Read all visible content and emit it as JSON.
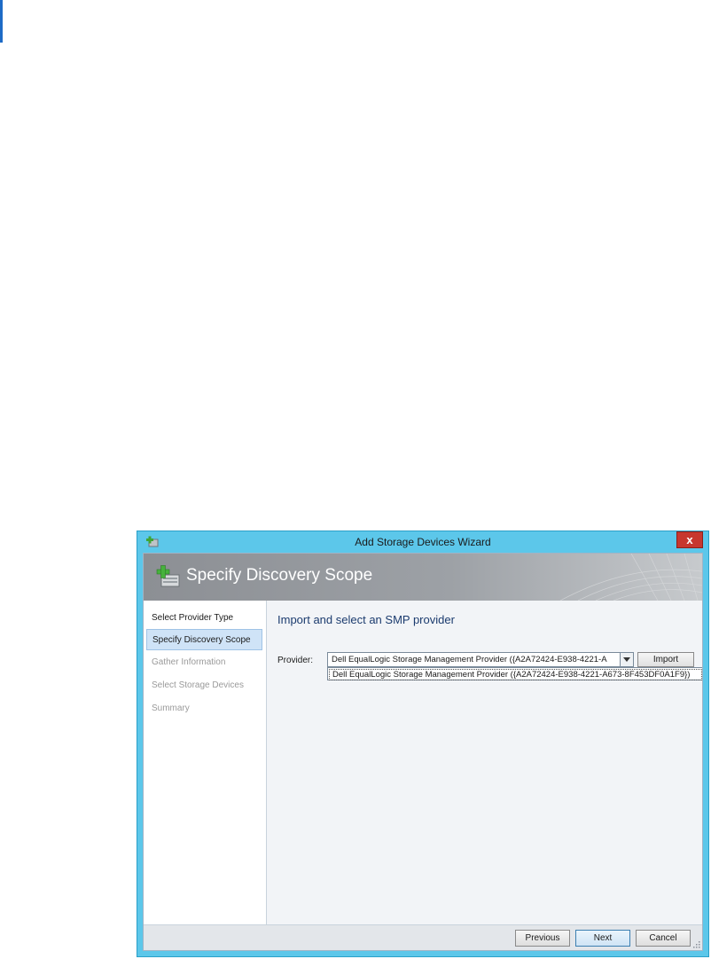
{
  "window": {
    "title": "Add Storage Devices Wizard",
    "close_glyph": "x"
  },
  "banner": {
    "title": "Specify Discovery Scope",
    "icon": "add-storage-icon"
  },
  "sidebar": {
    "steps": [
      {
        "label": "Select Provider Type",
        "state": "done"
      },
      {
        "label": "Specify Discovery Scope",
        "state": "active"
      },
      {
        "label": "Gather Information",
        "state": "future"
      },
      {
        "label": "Select Storage Devices",
        "state": "future"
      },
      {
        "label": "Summary",
        "state": "future"
      }
    ]
  },
  "main": {
    "heading": "Import and select an SMP provider",
    "provider_label": "Provider:",
    "provider_value": "Dell EqualLogic Storage Management Provider ({A2A72424-E938-4221-A",
    "dropdown_options": [
      "Dell EqualLogic Storage Management Provider ({A2A72424-E938-4221-A673-8F453DF0A1F9})"
    ],
    "import_label": "Import"
  },
  "footer": {
    "previous_label": "Previous",
    "next_label": "Next",
    "cancel_label": "Cancel"
  },
  "colors": {
    "accent": "#5cc7ea",
    "close": "#c7372f",
    "heading": "#1b3b6e",
    "active_step": "#cfe3f7"
  }
}
